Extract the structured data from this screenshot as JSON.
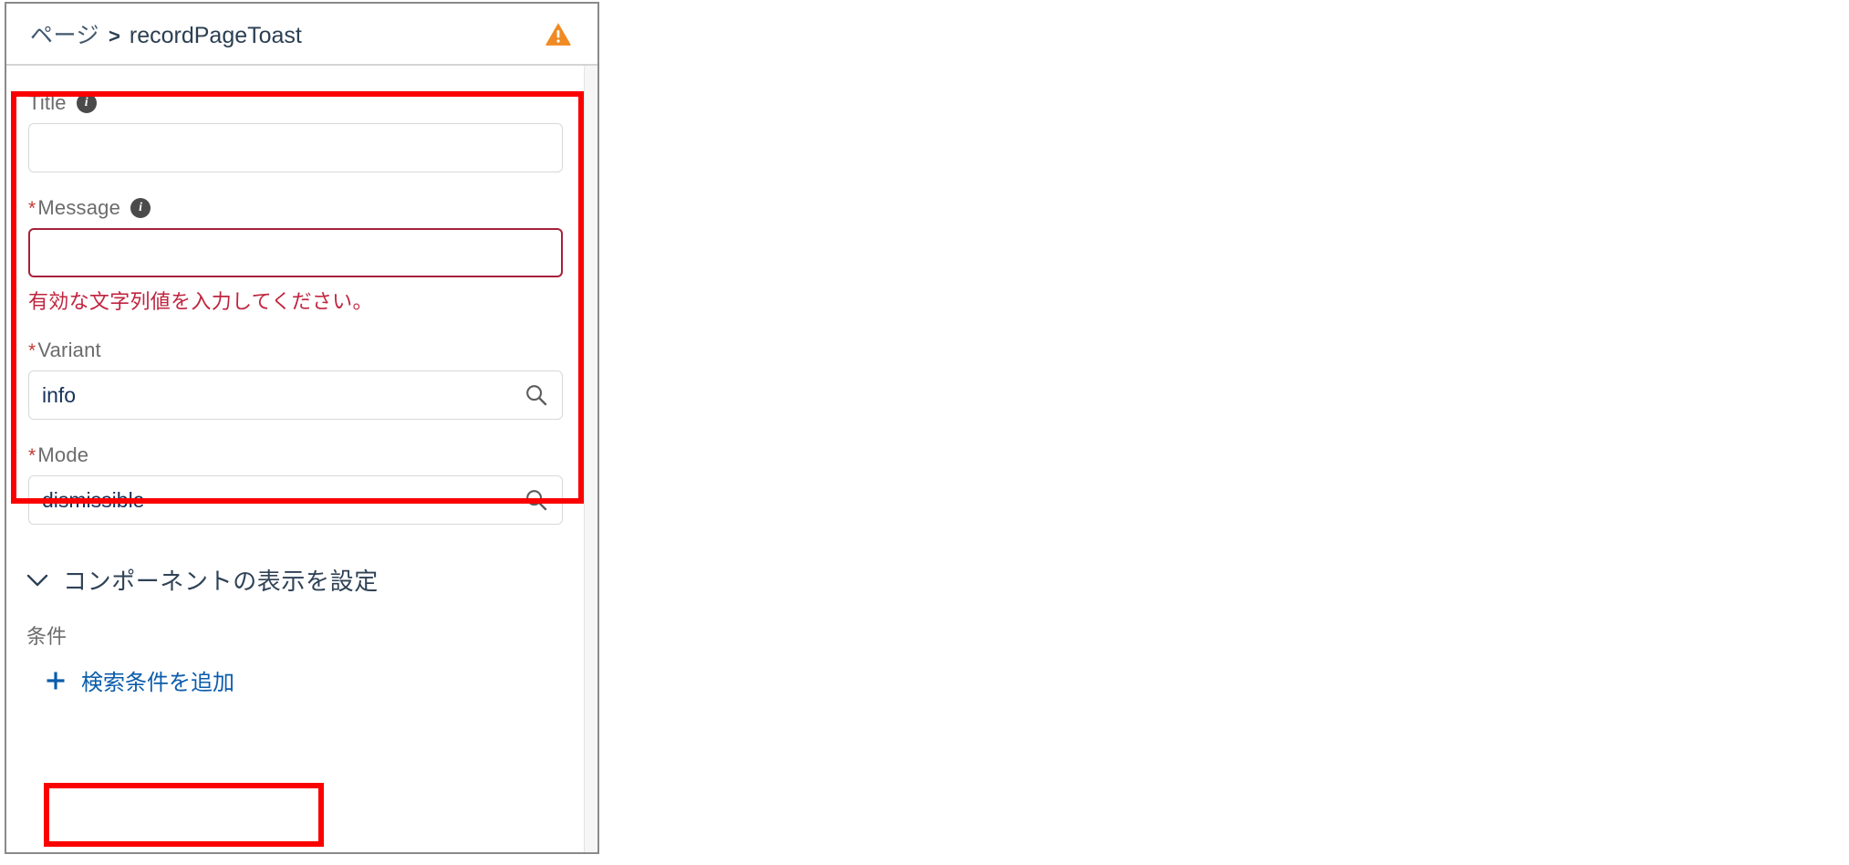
{
  "panel": {
    "breadcrumb": {
      "parent_label": "ページ",
      "separator": ">",
      "current_label": "recordPageToast",
      "warning_icon": "warning-triangle-icon",
      "warning_color": "#f08a24",
      "link_color": "#41586d"
    },
    "fields": [
      {
        "key": "title",
        "label": "Title",
        "required": false,
        "info_icon": "info-icon",
        "type": "text",
        "value": "",
        "placeholder": "",
        "error": null
      },
      {
        "key": "message",
        "label": "Message",
        "required": true,
        "required_marker": "*",
        "info_icon": "info-icon",
        "type": "text",
        "value": "",
        "placeholder": "",
        "error": "有効な文字列値を入力してください。",
        "error_color": "#c0243f"
      },
      {
        "key": "variant",
        "label": "Variant",
        "required": true,
        "required_marker": "*",
        "info_icon": null,
        "type": "combobox",
        "value": "info",
        "placeholder": "",
        "search_icon": "search-icon",
        "error": null
      },
      {
        "key": "mode",
        "label": "Mode",
        "required": true,
        "required_marker": "*",
        "info_icon": null,
        "type": "combobox",
        "value": "dismissible",
        "placeholder": "",
        "search_icon": "search-icon",
        "error": null
      }
    ],
    "visibility_section": {
      "chevron_icon": "chevron-down-icon",
      "title": "コンポーネントの表示を設定",
      "condition_label": "条件",
      "add_filter": {
        "plus_icon": "plus-icon",
        "label": "検索条件を追加",
        "color": "#0b5cab"
      }
    }
  },
  "annotations": {
    "highlight_color": "#fb0000",
    "boxes": [
      {
        "name": "fields-group-highlight"
      },
      {
        "name": "add-filter-highlight"
      }
    ]
  }
}
